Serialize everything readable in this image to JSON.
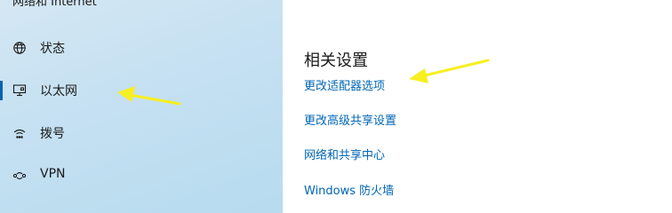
{
  "sidebar": {
    "heading": "网络和 Internet",
    "items": [
      {
        "label": "状态",
        "icon": "globe-icon",
        "selected": false
      },
      {
        "label": "以太网",
        "icon": "ethernet-icon",
        "selected": true
      },
      {
        "label": "拨号",
        "icon": "dialup-icon",
        "selected": false
      },
      {
        "label": "VPN",
        "icon": "vpn-icon",
        "selected": false
      }
    ]
  },
  "content": {
    "section_title": "相关设置",
    "links": [
      "更改适配器选项",
      "更改高级共享设置",
      "网络和共享中心",
      "Windows 防火墙"
    ]
  },
  "colors": {
    "sidebar_bg": "#c6e1f2",
    "accent": "#0063b1",
    "link": "#0066b4",
    "annotation": "#f7ef1f"
  }
}
